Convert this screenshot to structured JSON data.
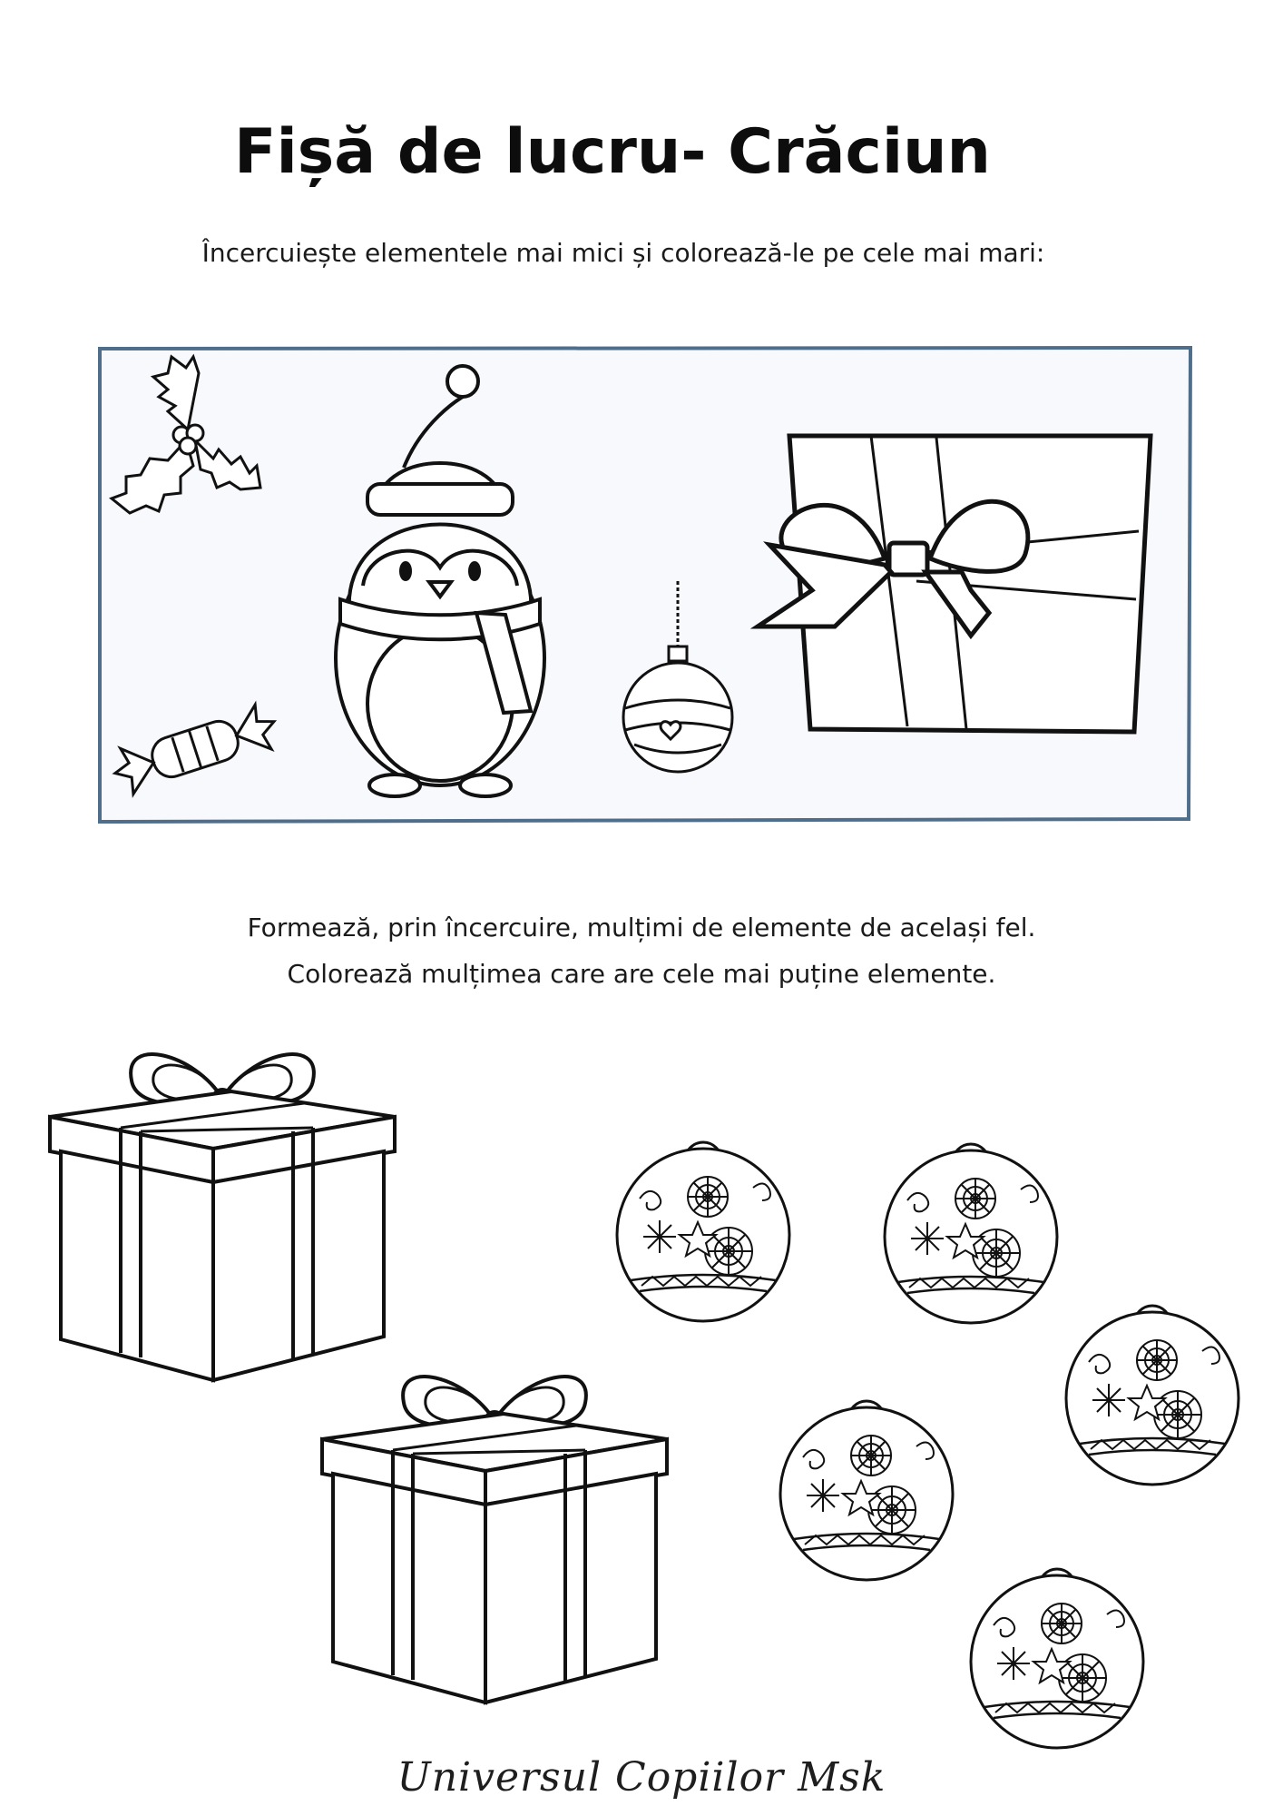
{
  "worksheet": {
    "title": "Fișă de lucru- Crăciun",
    "exercise1": {
      "instruction": "Încercuiește elementele mai mici și colorează-le pe cele mai mari:"
    },
    "exercise2": {
      "instruction_line1": "Formează, prin încercuire, mulțimi de elemente de același fel.",
      "instruction_line2": "Colorează mulțimea care are cele mai puține elemente."
    },
    "footer": "Universul Copiilor Msk"
  },
  "colors": {
    "frame_border": "#4f6e8c",
    "frame_fill": "#f7f9fc",
    "ink": "#111111"
  },
  "icons": [
    "holly-icon",
    "candy-icon",
    "penguin-icon",
    "ornament-icon",
    "gift-icon"
  ]
}
